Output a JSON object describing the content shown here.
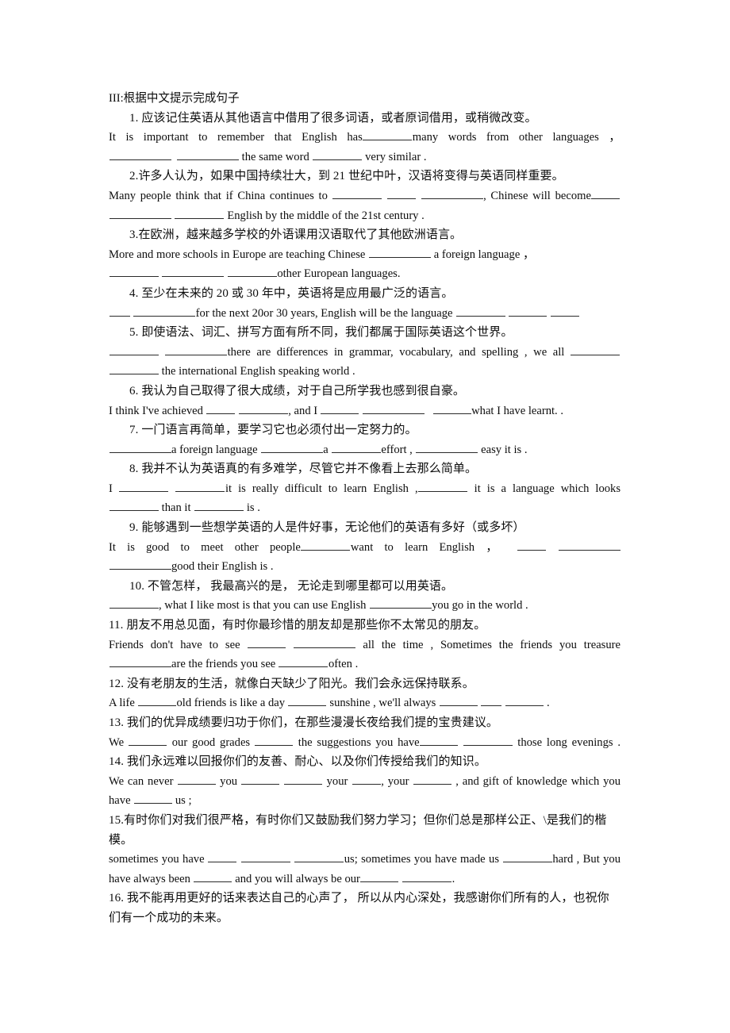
{
  "document": {
    "heading": "III:根据中文提示完成句子",
    "items": [
      {
        "number": "1.",
        "chinese": "应该记住英语从其他语言中借用了很多词语，或者原词借用，或稍微改变。",
        "english_parts": [
          "It is important to remember that English has",
          "many words from other languages ，",
          "the same word",
          "very similar ."
        ]
      },
      {
        "number": "2.",
        "chinese": "许多人认为，如果中国持续壮大，到 21 世纪中叶，汉语将变得与英语同样重要。",
        "english_parts": [
          "Many people think that if China continues to",
          ", Chinese will become",
          "English by the middle of the 21st century ."
        ]
      },
      {
        "number": "3.",
        "chinese": "在欧洲，越来越多学校的外语课用汉语取代了其他欧洲语言。",
        "english_parts": [
          "More and more schools in Europe are teaching Chinese",
          "a foreign language ，",
          "other European languages."
        ]
      },
      {
        "number": "4.",
        "chinese": "至少在未来的 20 或 30 年中，英语将是应用最广泛的语言。",
        "english_parts": [
          "for the next 20or 30 years, English will be the language"
        ]
      },
      {
        "number": "5.",
        "chinese": "即使语法、词汇、拼写方面有所不同，我们都属于国际英语这个世界。",
        "english_parts": [
          "there are differences in grammar, vocabulary, and spelling , we all",
          "the international English speaking world ."
        ]
      },
      {
        "number": "6.",
        "chinese": "我认为自己取得了很大成绩，对于自己所学我也感到很自豪。",
        "english_parts": [
          "I think I've achieved",
          ", and I",
          "what I have learnt. ."
        ]
      },
      {
        "number": "7.",
        "chinese": "一门语言再简单，要学习它也必须付出一定努力的。",
        "english_parts": [
          "a foreign language",
          "a",
          "effort ,",
          "easy it is ."
        ]
      },
      {
        "number": "8.",
        "chinese": "我并不认为英语真的有多难学，尽管它并不像看上去那么简单。",
        "english_parts": [
          "I",
          "it is really difficult to learn English ,",
          "it is a language which looks",
          "than it",
          "is ."
        ]
      },
      {
        "number": "9.",
        "chinese": "能够遇到一些想学英语的人是件好事，无论他们的英语有多好（或多坏）",
        "english_parts": [
          "It is good to meet other people",
          "want to learn English ，",
          "good their English is ."
        ]
      },
      {
        "number": "10.",
        "chinese": "不管怎样， 我最高兴的是， 无论走到哪里都可以用英语。",
        "english_parts": [
          ", what I like most is that you can use English",
          "you go in the world ."
        ]
      },
      {
        "number": "11.",
        "chinese": "朋友不用总见面，有时你最珍惜的朋友却是那些你不太常见的朋友。",
        "english_parts": [
          "Friends don't have to see",
          "all the time , Sometimes the friends you treasure",
          "are the friends you see",
          "often ."
        ]
      },
      {
        "number": "12.",
        "chinese": "没有老朋友的生活，就像白天缺少了阳光。我们会永远保持联系。",
        "english_parts": [
          "A life",
          "old friends is like a day",
          "sunshine , we'll always",
          "."
        ]
      },
      {
        "number": "13.",
        "chinese": "我们的优异成绩要归功于你们，在那些漫漫长夜给我们提的宝贵建议。",
        "english_parts": [
          "We",
          "our good grades",
          "the suggestions you have",
          "those long evenings ."
        ]
      },
      {
        "number": "14.",
        "chinese": "我们永远难以回报你们的友善、耐心、以及你们传授给我们的知识。",
        "english_parts": [
          "We can never",
          "you",
          "your",
          ", your",
          ", and gift of knowledge which you have",
          "us ;"
        ]
      },
      {
        "number": "15.",
        "chinese": "有时你们对我们很严格，有时你们又鼓励我们努力学习；但你们总是那样公正、\\是我们的楷模。",
        "english_parts": [
          "sometimes you have",
          "us; sometimes you have made us",
          "hard , But you have always been",
          "and you will always be our",
          "."
        ]
      },
      {
        "number": "16.",
        "chinese": "我不能再用更好的话来表达自己的心声了， 所以从内心深处，我感谢你们所有的人，也祝你们有一个成功的未来。",
        "english_parts": []
      }
    ]
  }
}
